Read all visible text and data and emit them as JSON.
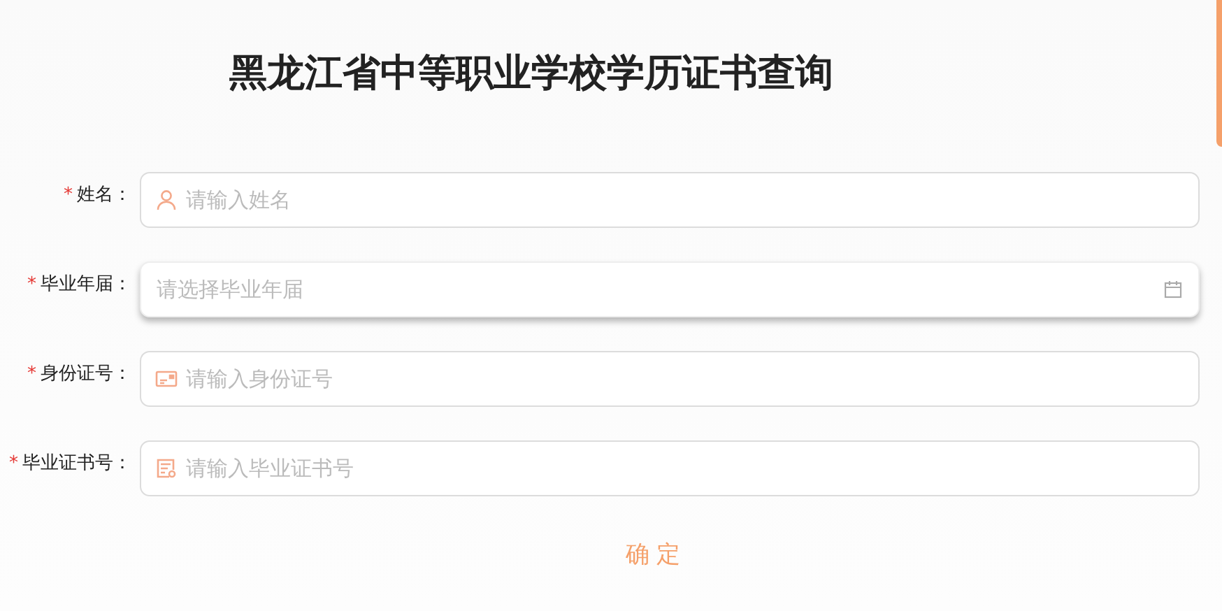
{
  "title": "黑龙江省中等职业学校学历证书查询",
  "fields": [
    {
      "label": "姓名",
      "required": true,
      "placeholder": "请输入姓名",
      "kind": "person",
      "focused": false
    },
    {
      "label": "毕业年届",
      "required": true,
      "placeholder": "请选择毕业年届",
      "kind": "date",
      "focused": true
    },
    {
      "label": "身份证号",
      "required": true,
      "placeholder": "请输入身份证号",
      "kind": "idcard",
      "focused": false
    },
    {
      "label": "毕业证书号",
      "required": true,
      "placeholder": "请输入毕业证书号",
      "kind": "certificate",
      "focused": false
    }
  ],
  "required_mark": "*",
  "label_suffix": "：",
  "submit": "确 定"
}
